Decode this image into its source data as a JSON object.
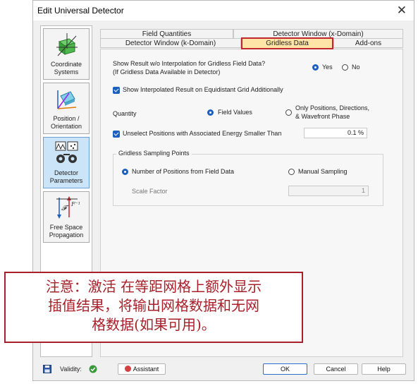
{
  "window": {
    "title": "Edit Universal Detector",
    "close_glyph": "✕"
  },
  "sidebar": {
    "items": [
      {
        "label_line1": "Coordinate",
        "label_line2": "Systems",
        "icon": "coordinate-systems-icon"
      },
      {
        "label_line1": "Position /",
        "label_line2": "Orientation",
        "icon": "position-orientation-icon"
      },
      {
        "label_line1": "Detector",
        "label_line2": "Parameters",
        "icon": "detector-parameters-icon"
      },
      {
        "label_line1": "Free Space",
        "label_line2": "Propagation",
        "icon": "free-space-propagation-icon"
      }
    ],
    "active_index": 2
  },
  "tabs": {
    "field_quantities": "Field Quantities",
    "detector_window_x": "Detector Window (x-Domain)",
    "detector_window_k": "Detector Window (k-Domain)",
    "gridless_data": "Gridless Data",
    "addons": "Add-ons"
  },
  "panel": {
    "show_result_line1": "Show Result w/o Interpolation for Gridless Field Data?",
    "show_result_line2": "(If Gridless Data Available in Detector)",
    "yes_label": "Yes",
    "no_label": "No",
    "show_interpolated_label": "Show Interpolated Result on Equidistant Grid Additionally",
    "quantity_label": "Quantity",
    "field_values_label": "Field Values",
    "only_positions_line1": "Only Positions, Directions,",
    "only_positions_line2": "& Wavefront Phase",
    "unselect_positions_label": "Unselect Positions with Associated Energy Smaller Than",
    "energy_threshold_value": "0.1 %",
    "gridless_group_label": "Gridless Sampling Points",
    "number_positions_label": "Number of Positions from Field Data",
    "manual_sampling_label": "Manual Sampling",
    "scale_factor_label": "Scale Factor",
    "scale_factor_value": "1"
  },
  "note": {
    "line1": "注意：激活 在等距网格上额外显示",
    "line2": "插值结果，将输出网格数据和无网",
    "line3": "格数据(如果可用)。"
  },
  "footer": {
    "validity_label": "Validity:",
    "assistant_label": "Assistant",
    "ok_label": "OK",
    "cancel_label": "Cancel",
    "help_label": "Help"
  },
  "colors": {
    "accent": "#1d5fbf",
    "highlight_tab": "#ffe4a8",
    "annotation_red": "#a8202a",
    "valid_green": "#3a9a3a"
  }
}
